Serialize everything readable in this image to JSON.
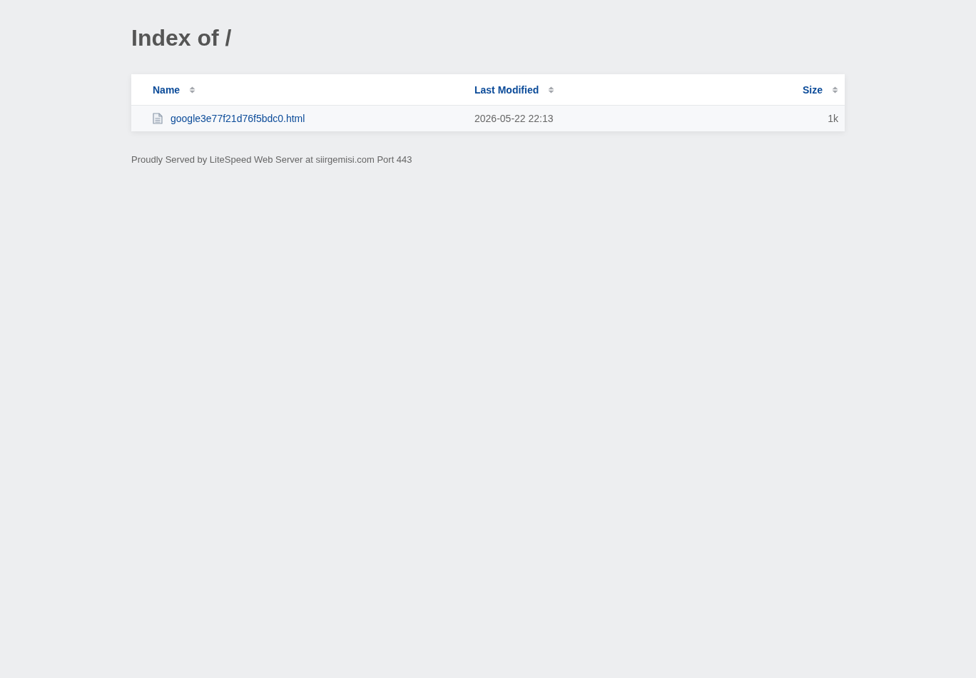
{
  "title": "Index of /",
  "table": {
    "columns": [
      {
        "label": "Name"
      },
      {
        "label": "Last Modified"
      },
      {
        "label": "Size"
      }
    ],
    "rows": [
      {
        "kind": "file",
        "name": "google3e77f21d76f5bdc0.html",
        "modified": "2026-05-22 22:13",
        "size": "1k"
      }
    ]
  },
  "footer": "Proudly Served by LiteSpeed Web Server at siirgemisi.com Port 443"
}
